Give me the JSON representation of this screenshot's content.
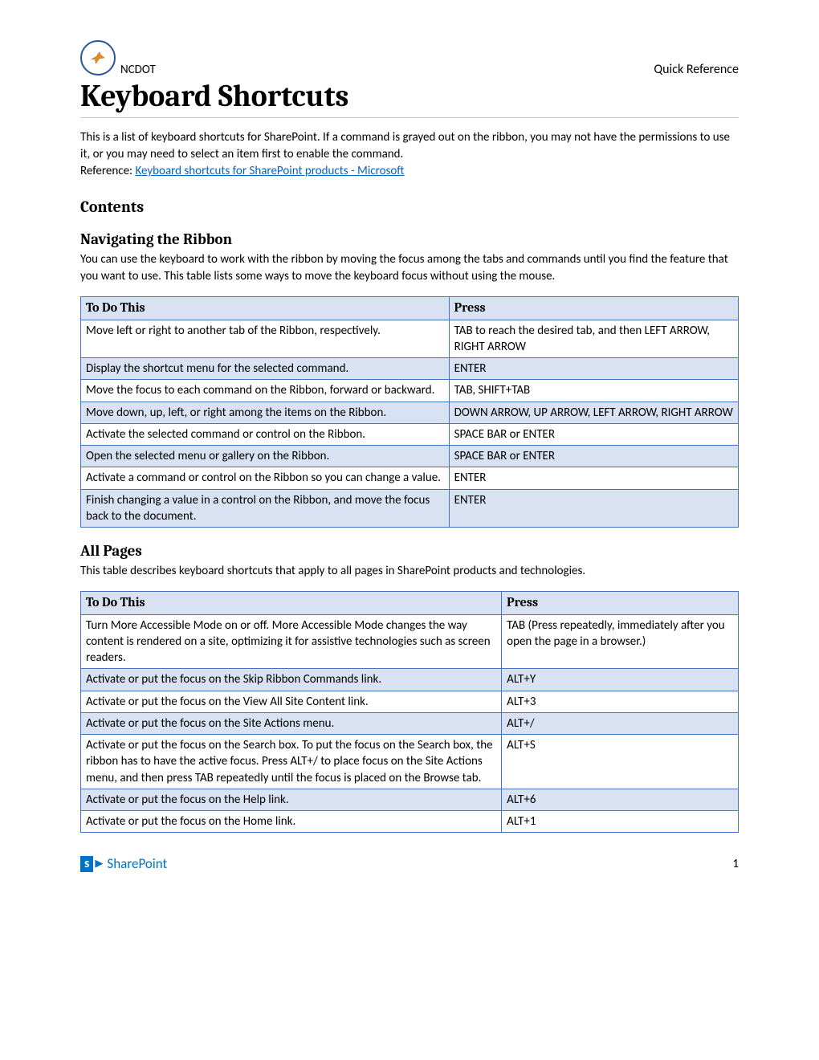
{
  "header": {
    "org": "NCDOT",
    "doc_type": "Quick Reference"
  },
  "title": "Keyboard Shortcuts",
  "intro": {
    "p1": "This is a list of keyboard shortcuts for SharePoint. If a command is grayed out on the ribbon, you may not have the permissions to use it, or you may need to select an item first to enable the command.",
    "ref_label": "Reference: ",
    "ref_link": "Keyboard shortcuts for SharePoint products - Microsoft"
  },
  "contents_heading": "Contents",
  "section1": {
    "heading": "Navigating the Ribbon",
    "desc": "You can use the keyboard to work with the ribbon by moving the focus among the tabs and commands until you find the feature that you want to use. This table lists some ways to move the keyboard focus without using the mouse.",
    "col_action": "To Do This",
    "col_press": "Press",
    "rows": [
      {
        "action": "Move left or right to another tab of the Ribbon, respectively.",
        "press": "TAB to reach the desired tab, and then LEFT ARROW, RIGHT ARROW"
      },
      {
        "action": "Display the shortcut menu for the selected command.",
        "press": "ENTER"
      },
      {
        "action": "Move the focus to each command on the Ribbon, forward or backward.",
        "press": "TAB, SHIFT+TAB"
      },
      {
        "action": "Move down, up, left, or right among the items on the Ribbon.",
        "press": "DOWN ARROW, UP ARROW, LEFT ARROW, RIGHT ARROW"
      },
      {
        "action": "Activate the selected command or control on the Ribbon.",
        "press": "SPACE BAR or ENTER"
      },
      {
        "action": "Open the selected menu or gallery on the Ribbon.",
        "press": "SPACE BAR or ENTER"
      },
      {
        "action": "Activate a command or control on the Ribbon so you can change a value.",
        "press": "ENTER"
      },
      {
        "action": "Finish changing a value in a control on the Ribbon, and move the focus back to the document.",
        "press": "ENTER"
      }
    ]
  },
  "section2": {
    "heading": "All Pages",
    "desc": "This table describes keyboard shortcuts that apply to all pages in SharePoint products and technologies.",
    "col_action": "To Do This",
    "col_press": "Press",
    "rows": [
      {
        "action": "Turn More Accessible Mode on or off.\nMore Accessible Mode changes the way content is rendered on a site, optimizing it for assistive technologies such as screen readers.",
        "press": "TAB (Press repeatedly, immediately after you open the page in a browser.)"
      },
      {
        "action": "Activate or put the focus on the Skip Ribbon Commands link.",
        "press": "ALT+Y"
      },
      {
        "action": "Activate or put the focus on the View All Site Content link.",
        "press": "ALT+3"
      },
      {
        "action": "Activate or put the focus on the Site Actions menu.",
        "press": "ALT+/"
      },
      {
        "action": "Activate or put the focus on the Search box.\nTo put the focus on the Search box, the ribbon has to have the active focus. Press ALT+/ to place focus on the Site Actions menu, and then press TAB repeatedly until the focus is placed on the Browse tab.",
        "press": "ALT+S"
      },
      {
        "action": "Activate or put the focus on the Help link.",
        "press": "ALT+6"
      },
      {
        "action": "Activate or put the focus on the Home link.",
        "press": "ALT+1"
      }
    ]
  },
  "footer": {
    "product": "SharePoint",
    "page": "1"
  }
}
